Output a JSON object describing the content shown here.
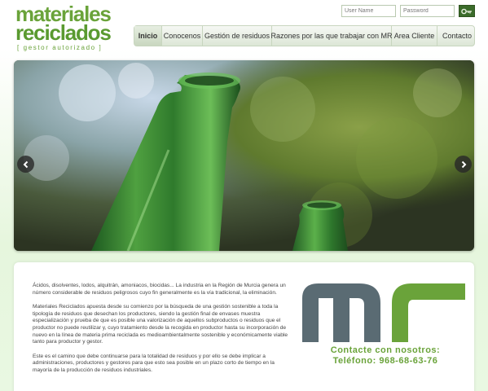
{
  "brand": {
    "line1": "materiales",
    "line2": "reciclados",
    "tagline": "[ gestor autorizado ]"
  },
  "login": {
    "user_placeholder": "User Name",
    "password_placeholder": "Password",
    "submit_icon": "key-icon"
  },
  "nav": {
    "items": [
      {
        "label": "Inicio",
        "active": true
      },
      {
        "label": "Conocenos"
      },
      {
        "label": "Gestión de residuos"
      },
      {
        "label": "Razones por las que trabajar con MR"
      },
      {
        "label": "Area Cliente"
      },
      {
        "label": "Contacto"
      }
    ]
  },
  "slider": {
    "prev_icon": "chevron-left-icon",
    "next_icon": "chevron-right-icon"
  },
  "content": {
    "paragraphs": [
      "Ácidos, disolventes, lodos, alquitrán, amoniacos, biocidas... La industria en la Región de Murcia genera un número considerable de residuos peligrosos cuyo fin generalmente es la vía tradicional, la eliminación.",
      "Materiales Reciclados apuesta desde su comienzo por la búsqueda de una gestión sostenible a toda la tipología de residuos que desechan los productores, siendo la gestión final de envases muestra especialización y prueba de que es posible una valorización de aquellos subproductos o residuos que el productor no puede reutilizar y, cuyo tratamiento desde la recogida en productor hasta su incorporación de nuevo en la línea de materia prima reciclada es medioambientalmente sostenible y económicamente viable tanto para productor y gestor.",
      "Este es el camino que debe continuarse para la totalidad de residuos y por ello se debe implicar a administraciones, productores y gestores para que esto sea posible en un plazo corto de tiempo en la mayoría de la producción de residuos industriales."
    ],
    "contact_title": "Contacte con nosotros:",
    "contact_phone": "Teléfono: 968-68-63-76"
  },
  "colors": {
    "brand_green": "#6aa33a",
    "logo_gray": "#5a6b73"
  }
}
